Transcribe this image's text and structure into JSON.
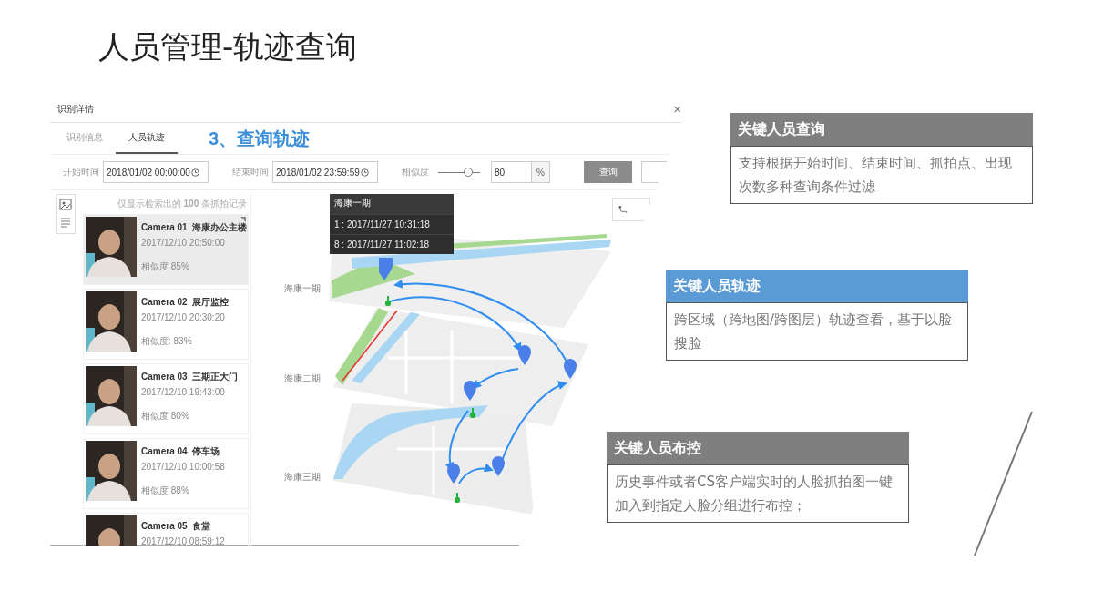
{
  "title": "人员管理-轨迹查询",
  "window": {
    "title": "识别详情",
    "close": "×"
  },
  "tabs": [
    {
      "label": "识别信息",
      "selected": false
    },
    {
      "label": "人员轨迹",
      "selected": true
    }
  ],
  "step_note": "3、查询轨迹",
  "filters": {
    "start_label": "开始时间",
    "start_value": "2018/01/02 00:00:00",
    "end_label": "结束时间",
    "end_value": "2018/01/02 23:59:59",
    "similarity_label": "相似度",
    "similarity_slider": {
      "level": 0.72
    },
    "similarity_value": "80",
    "unit": "%",
    "query_button": "查询"
  },
  "list": {
    "note": "仅显示检索出的 **100** 条抓拍记录",
    "items": [
      {
        "camera": "Camera 01",
        "place": "海康办公主楼",
        "time": "2017/12/10 20:50:00",
        "similarity": "相似度 85%",
        "selected": true
      },
      {
        "camera": "Camera 02",
        "place": "展厅监控",
        "time": "2017/12/10 20:30:20",
        "similarity": "相似度: 83%",
        "selected": false
      },
      {
        "camera": "Camera 03",
        "place": "三期正大门",
        "time": "2017/12/10 19:43:00",
        "similarity": "相似度 80%",
        "selected": false
      },
      {
        "camera": "Camera 04",
        "place": "停车场",
        "time": "2017/12/10 10:00:58",
        "similarity": "相似度 88%",
        "selected": false
      },
      {
        "camera": "Camera 05",
        "place": "食堂",
        "time": "2017/12/10 08:59:12",
        "selected": false
      }
    ]
  },
  "map": {
    "tooltip": {
      "title": "海康一期",
      "lines": [
        "1 : 2017/11/27 10:31:18",
        "8 : 2017/11/27 11:02:18"
      ]
    },
    "layers": [
      "海康一期",
      "海康二期",
      "海康三期"
    ]
  },
  "features": [
    {
      "title": "关键人员查询",
      "text": "支持根据开始时间、结束时间、抓拍点、出现次数多种查询条件过滤",
      "color": "#7f7f7f"
    },
    {
      "title": "关键人员轨迹",
      "text": "跨区域（跨地图/跨图层）轨迹查看，基于以脸搜脸",
      "color": "#5b9bd5"
    },
    {
      "title": "关键人员布控",
      "text": "历史事件或者CS客户端实时的人脸抓拍图一键加入到指定人脸分组进行布控；",
      "color": "#7f7f7f"
    }
  ]
}
